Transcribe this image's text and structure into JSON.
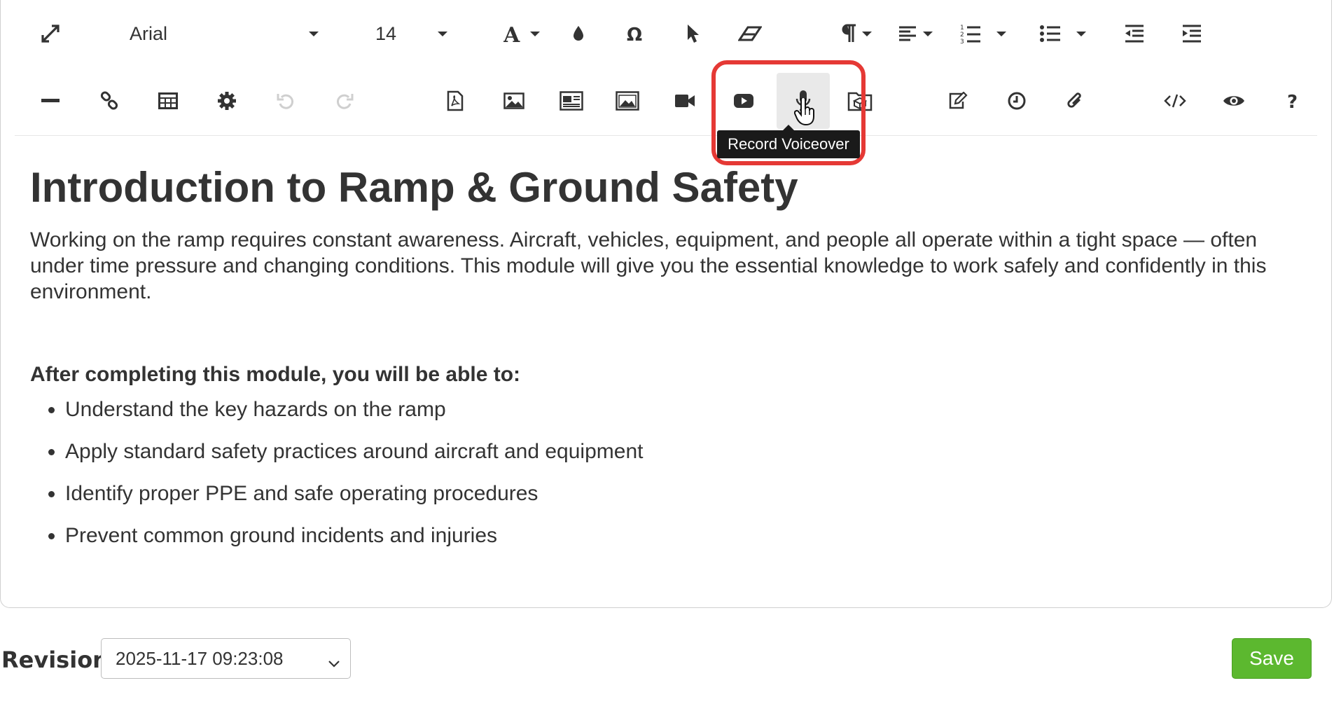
{
  "toolbar": {
    "font_family": "Arial",
    "font_size": "14",
    "icons_row1": [
      "fullscreen-icon",
      "font-family-dropdown",
      "font-size-dropdown",
      "text-color-icon",
      "highlight-color-icon",
      "special-character-icon",
      "select-icon",
      "clear-formatting-icon",
      "paragraph-format-icon",
      "align-icon",
      "ordered-list-icon",
      "unordered-list-icon",
      "outdent-icon",
      "indent-icon"
    ],
    "icons_row2": [
      "horizontal-line-icon",
      "link-icon",
      "table-icon",
      "settings-icon",
      "undo-icon",
      "redo-icon",
      "pdf-icon",
      "image-icon",
      "image-text-icon",
      "image-gallery-icon",
      "video-icon",
      "youtube-icon",
      "microphone-icon",
      "3d-object-icon",
      "edit-icon",
      "clock-icon",
      "attachment-icon",
      "code-view-icon",
      "preview-icon",
      "help-icon"
    ]
  },
  "tooltip": {
    "text": "Record Voiceover"
  },
  "content": {
    "title": "Introduction to Ramp & Ground Safety",
    "intro": "Working on the ramp requires constant awareness. Aircraft, vehicles, equipment, and people all operate within a tight space — often under time pressure and changing conditions. This module will give you the essential knowledge to work safely and confidently in this environment.",
    "objectives_heading": "After completing this module, you will be able to:",
    "objectives": [
      "Understand the key hazards on the ramp",
      "Apply standard safety practices around aircraft and equipment",
      "Identify proper PPE and safe operating procedures",
      "Prevent common ground incidents and injuries"
    ]
  },
  "footer": {
    "revision_label": "Revision",
    "revision_value": "2025-11-17 09:23:08",
    "save_label": "Save"
  },
  "colors": {
    "highlight": "#e53935",
    "save_button": "#5cb82f",
    "tooltip_bg": "#1a1a1a"
  }
}
